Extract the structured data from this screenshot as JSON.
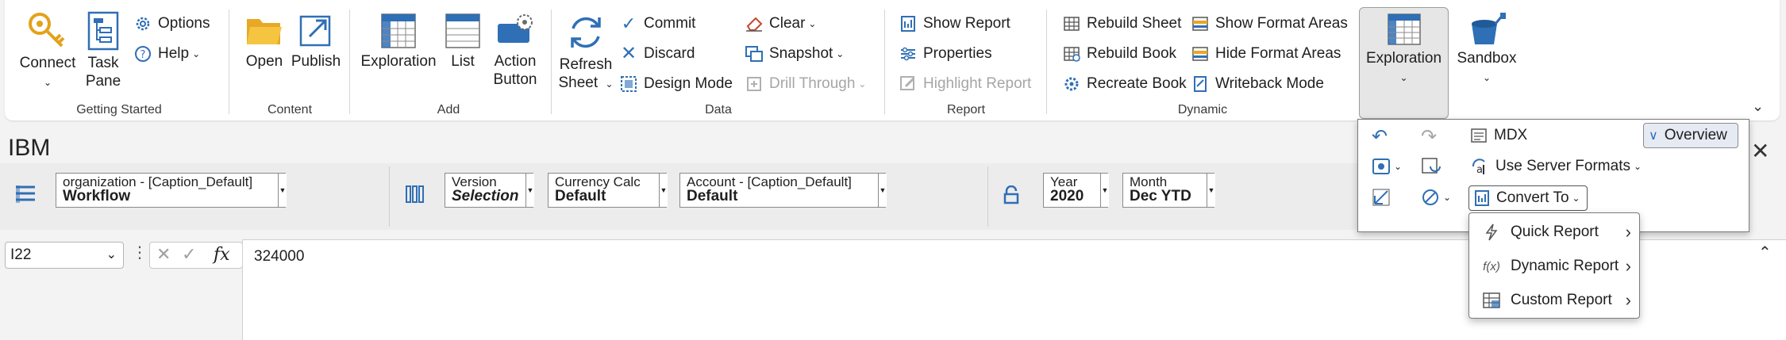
{
  "colors": {
    "accent_blue": "#2f6fb5",
    "selected_bg": "#e6e6e6",
    "ribbon_bg": "#ffffff"
  },
  "ribbon": {
    "groups": [
      {
        "label": "Getting Started"
      },
      {
        "label": "Content"
      },
      {
        "label": "Add"
      },
      {
        "label": "Data"
      },
      {
        "label": "Report"
      },
      {
        "label": "Dynamic"
      }
    ],
    "connect": {
      "label": "Connect"
    },
    "task_pane": {
      "line1": "Task",
      "line2": "Pane"
    },
    "options": {
      "label": "Options"
    },
    "help": {
      "label": "Help"
    },
    "open": {
      "label": "Open"
    },
    "publish": {
      "label": "Publish"
    },
    "exploration_add": {
      "label": "Exploration"
    },
    "list": {
      "label": "List"
    },
    "action_button": {
      "line1": "Action",
      "line2": "Button"
    },
    "refresh": {
      "line1": "Refresh",
      "line2": "Sheet"
    },
    "commit": {
      "label": "Commit"
    },
    "discard": {
      "label": "Discard"
    },
    "design_mode": {
      "label": "Design Mode"
    },
    "clear": {
      "label": "Clear"
    },
    "snapshot": {
      "label": "Snapshot"
    },
    "drill_through": {
      "label": "Drill Through"
    },
    "show_report": {
      "label": "Show Report"
    },
    "properties": {
      "label": "Properties"
    },
    "highlight_report": {
      "label": "Highlight Report"
    },
    "rebuild_sheet": {
      "label": "Rebuild Sheet"
    },
    "rebuild_book": {
      "label": "Rebuild Book"
    },
    "recreate_book": {
      "label": "Recreate Book"
    },
    "show_format_areas": {
      "label": "Show Format Areas"
    },
    "hide_format_areas": {
      "label": "Hide Format Areas"
    },
    "writeback_mode": {
      "label": "Writeback Mode"
    },
    "exploration": {
      "label": "Exploration"
    },
    "sandbox": {
      "label": "Sandbox"
    }
  },
  "workbook": {
    "title": "IBM"
  },
  "context": {
    "organization": {
      "title": "organization - [Caption_Default]",
      "value": "Workflow"
    },
    "version": {
      "title": "Version",
      "value": "Selection"
    },
    "currency": {
      "title": "Currency Calc",
      "value": "Default"
    },
    "account": {
      "title": "Account - [Caption_Default]",
      "value": "Default"
    },
    "year": {
      "title": "Year",
      "value": "2020"
    },
    "month": {
      "title": "Month",
      "value": "Dec YTD"
    }
  },
  "formula_bar": {
    "cell_ref": "I22",
    "formula": "324000",
    "fx": "fx"
  },
  "popup": {
    "mdx": {
      "label": "MDX"
    },
    "overview": {
      "label": "Overview"
    },
    "use_server_formats": {
      "label": "Use Server Formats"
    },
    "convert_to": {
      "label": "Convert To"
    },
    "menu": [
      {
        "label": "Quick Report"
      },
      {
        "label": "Dynamic Report"
      },
      {
        "label": "Custom Report"
      }
    ]
  }
}
